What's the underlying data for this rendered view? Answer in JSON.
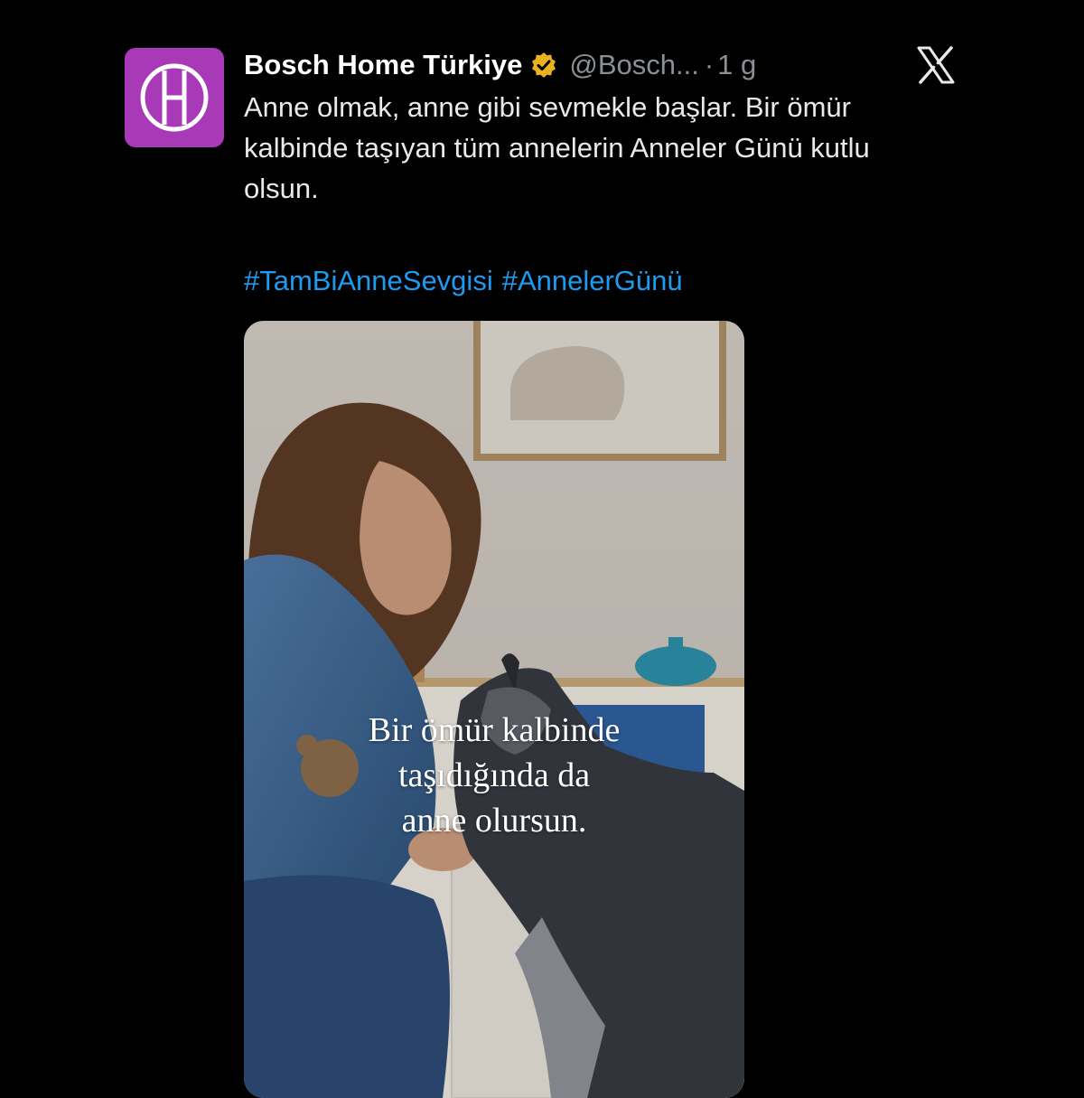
{
  "tweet": {
    "author_name": "Bosch Home Türkiye",
    "handle": "@Bosch...",
    "separator": "·",
    "time": "1 g",
    "body": "Anne olmak, anne gibi sevmekle başlar. Bir ömür kalbinde taşıyan tüm annelerin Anneler Günü kutlu olsun.",
    "hashtags": [
      "#TamBiAnneSevgisi",
      "#AnnelerGünü"
    ]
  },
  "media": {
    "caption_lines": [
      "Bir ömür kalbinde",
      "taşıdığında da",
      "anne olursun."
    ]
  },
  "icons": {
    "avatar": "bosch-logo-icon",
    "verified": "verified-badge-icon",
    "platform": "x-logo-icon"
  },
  "colors": {
    "background": "#000000",
    "avatar_bg": "#a83ab8",
    "verified_gold": "#e8b31c",
    "hashtag": "#1d9bf0",
    "secondary_text": "#8b9096"
  }
}
